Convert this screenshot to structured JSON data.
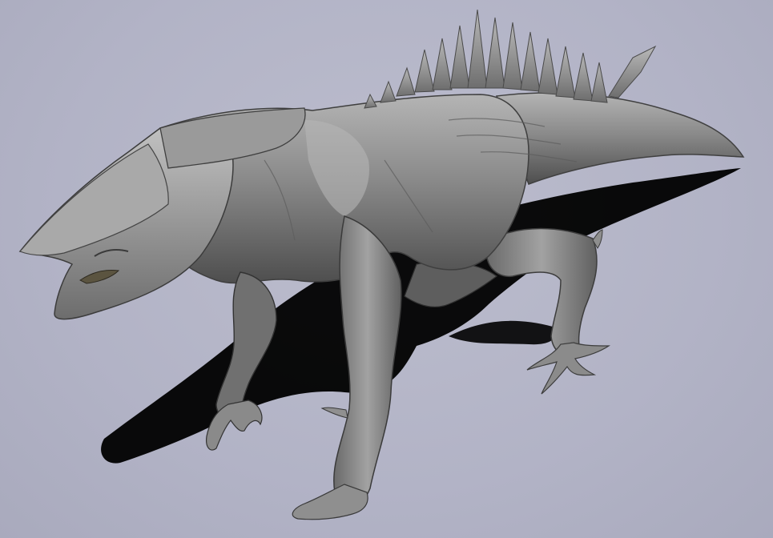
{
  "scene": {
    "subject": "creature-sculpt",
    "colors": {
      "background": "#b2b3c6",
      "shadow": "#000000",
      "skin_light": "#a8a8a8",
      "skin_mid": "#7d7d7d",
      "skin_dark": "#4a4a4a",
      "spine": "#8c8c8c"
    }
  }
}
